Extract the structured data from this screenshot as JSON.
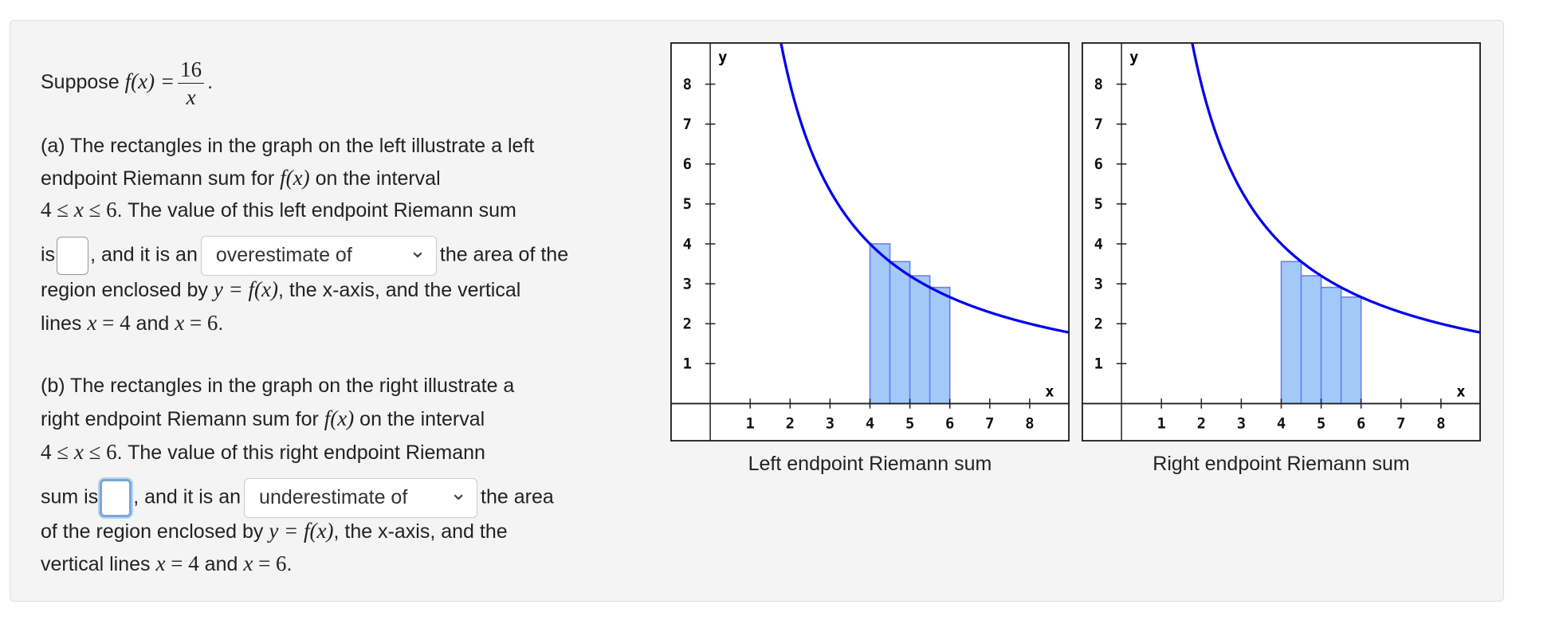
{
  "problem": {
    "intro": [
      {
        "t": "Suppose "
      },
      {
        "m": "f(x) ="
      },
      {
        "frac": {
          "num": "16",
          "den": "x"
        }
      },
      {
        "t": "."
      }
    ],
    "part_a": [
      [
        {
          "t": "(a) The rectangles in the graph on the left illustrate a left"
        }
      ],
      [
        {
          "t": "endpoint Riemann sum for "
        },
        {
          "m": "f(x)"
        },
        {
          "t": " on the interval"
        }
      ],
      [
        {
          "n": "4 ≤ "
        },
        {
          "m": "x"
        },
        {
          "n": " ≤ 6"
        },
        {
          "t": ". The value of this left endpoint Riemann sum"
        }
      ],
      [
        {
          "t": "is"
        },
        {
          "box": "a"
        },
        {
          "t": ", and it is an"
        },
        {
          "select": "a"
        },
        {
          "t": "the area of the"
        }
      ],
      [
        {
          "t": "region enclosed by "
        },
        {
          "m": "y = f(x)"
        },
        {
          "t": ", the x-axis, and the vertical"
        }
      ],
      [
        {
          "t": "lines "
        },
        {
          "m": "x"
        },
        {
          "n": " = 4"
        },
        {
          "t": " and "
        },
        {
          "m": "x"
        },
        {
          "n": " = 6"
        },
        {
          "t": "."
        }
      ]
    ],
    "part_b": [
      [
        {
          "t": "(b) The rectangles in the graph on the right illustrate a"
        }
      ],
      [
        {
          "t": "right endpoint Riemann sum for "
        },
        {
          "m": "f(x)"
        },
        {
          "t": " on the interval"
        }
      ],
      [
        {
          "n": "4 ≤ "
        },
        {
          "m": "x"
        },
        {
          "n": " ≤ 6"
        },
        {
          "t": ". The value of this right endpoint Riemann"
        }
      ],
      [
        {
          "t": "sum is"
        },
        {
          "box": "b"
        },
        {
          "t": ", and it is an"
        },
        {
          "select": "b"
        },
        {
          "t": "the area"
        }
      ],
      [
        {
          "t": "of the region enclosed by "
        },
        {
          "m": "y = f(x)"
        },
        {
          "t": ", the x-axis, and the"
        }
      ],
      [
        {
          "t": "vertical lines "
        },
        {
          "m": "x"
        },
        {
          "n": " = 4"
        },
        {
          "t": " and "
        },
        {
          "m": "x"
        },
        {
          "n": " = 6"
        },
        {
          "t": "."
        }
      ]
    ]
  },
  "inputs": {
    "a": {
      "answer": "",
      "select_value": "overestimate of"
    },
    "b": {
      "answer": "",
      "select_value": "underestimate of",
      "focused": true
    }
  },
  "chart_data": [
    {
      "type": "line",
      "title": "Left endpoint Riemann sum",
      "function": "16/x",
      "xlabel": "x",
      "ylabel": "y",
      "xlim": [
        -1,
        9
      ],
      "ylim": [
        -0.95,
        9.05
      ],
      "xticks": [
        "1",
        "2",
        "3",
        "4",
        "5",
        "6",
        "7",
        "8"
      ],
      "yticks": [
        "1",
        "2",
        "3",
        "4",
        "5",
        "6",
        "7",
        "8"
      ],
      "rectangles": [
        {
          "x0": 4,
          "x1": 4.5,
          "height": 4
        },
        {
          "x0": 4.5,
          "x1": 5,
          "height": 3.556
        },
        {
          "x0": 5,
          "x1": 5.5,
          "height": 3.2
        },
        {
          "x0": 5.5,
          "x1": 6,
          "height": 2.909
        }
      ],
      "curve_color": "#0000ee",
      "rect_fill": "#a3c9f9",
      "rect_stroke": "#6b80ee"
    },
    {
      "type": "line",
      "title": "Right endpoint Riemann sum",
      "function": "16/x",
      "xlabel": "x",
      "ylabel": "y",
      "xlim": [
        -1,
        9
      ],
      "ylim": [
        -0.95,
        9.05
      ],
      "xticks": [
        "1",
        "2",
        "3",
        "4",
        "5",
        "6",
        "7",
        "8"
      ],
      "yticks": [
        "1",
        "2",
        "3",
        "4",
        "5",
        "6",
        "7",
        "8"
      ],
      "rectangles": [
        {
          "x0": 4,
          "x1": 4.5,
          "height": 3.556
        },
        {
          "x0": 4.5,
          "x1": 5,
          "height": 3.2
        },
        {
          "x0": 5,
          "x1": 5.5,
          "height": 2.909
        },
        {
          "x0": 5.5,
          "x1": 6,
          "height": 2.667
        }
      ],
      "curve_color": "#0000ee",
      "rect_fill": "#a3c9f9",
      "rect_stroke": "#6b80ee"
    }
  ]
}
